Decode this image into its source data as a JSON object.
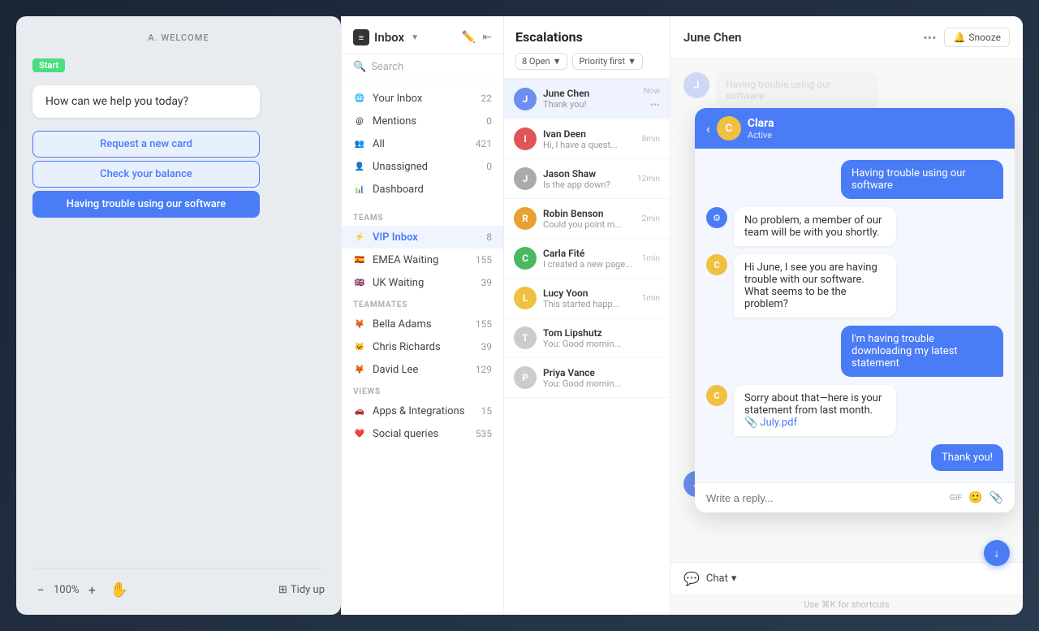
{
  "chatbot": {
    "label": "A. WELCOME",
    "start_badge": "Start",
    "bot_question": "How can we help you today?",
    "buttons": [
      {
        "id": "request-card",
        "label": "Request a new card"
      },
      {
        "id": "check-balance",
        "label": "Check your balance"
      },
      {
        "id": "trouble-software",
        "label": "Having trouble using our software"
      }
    ],
    "zoom": "100%",
    "tidy_label": "Tidy up"
  },
  "inbox": {
    "title": "Inbox",
    "search_placeholder": "Search",
    "items": [
      {
        "id": "your-inbox",
        "icon": "🌐",
        "label": "Your Inbox",
        "count": "22"
      },
      {
        "id": "mentions",
        "icon": "@",
        "label": "Mentions",
        "count": "0"
      },
      {
        "id": "all",
        "icon": "👥",
        "label": "All",
        "count": "421"
      },
      {
        "id": "unassigned",
        "icon": "👤",
        "label": "Unassigned",
        "count": "0"
      },
      {
        "id": "dashboard",
        "icon": "📊",
        "label": "Dashboard",
        "count": ""
      }
    ],
    "teams_label": "TEAMS",
    "teams": [
      {
        "id": "vip-inbox",
        "icon": "⚡",
        "label": "VIP Inbox",
        "count": "8",
        "active": true
      },
      {
        "id": "emea-waiting",
        "icon": "🇪🇸",
        "label": "EMEA Waiting",
        "count": "155"
      },
      {
        "id": "uk-waiting",
        "icon": "🇬🇧",
        "label": "UK Waiting",
        "count": "39"
      }
    ],
    "teammates_label": "TEAMMATES",
    "teammates": [
      {
        "id": "bella-adams",
        "icon": "🦊",
        "label": "Bella Adams",
        "count": "155"
      },
      {
        "id": "chris-richards",
        "icon": "🐱",
        "label": "Chris Richards",
        "count": "39"
      },
      {
        "id": "david-lee",
        "icon": "🦊",
        "label": "David Lee",
        "count": "129"
      }
    ],
    "views_label": "VIEWS",
    "views": [
      {
        "id": "apps-integrations",
        "icon": "🚗",
        "label": "Apps & Integrations",
        "count": "15"
      },
      {
        "id": "social-queries",
        "icon": "❤️",
        "label": "Social queries",
        "count": "535"
      }
    ]
  },
  "escalations": {
    "title": "Escalations",
    "filter_open": "8 Open",
    "filter_priority": "Priority first",
    "conversations": [
      {
        "id": "june-chen",
        "name": "June Chen",
        "preview": "Thank you!",
        "time": "Now",
        "color": "#6b8ef0",
        "active": true
      },
      {
        "id": "ivan-deen",
        "name": "Ivan Deen",
        "preview": "Hi, I have a quest...",
        "time": "8min",
        "color": "#e05555"
      },
      {
        "id": "jason-shaw",
        "name": "Jason Shaw",
        "preview": "Is the app down?",
        "time": "12min",
        "color": "#aaa"
      },
      {
        "id": "robin-benson",
        "name": "Robin Benson",
        "preview": "Could you point m...",
        "time": "2min",
        "color": "#e8a030"
      },
      {
        "id": "carla-fite",
        "name": "Carla Fité",
        "preview": "I created a new page...",
        "time": "1min",
        "color": "#4ab860"
      },
      {
        "id": "lucy-yoon",
        "name": "Lucy Yoon",
        "preview": "This started happ...",
        "time": "1min",
        "color": "#f0c040"
      },
      {
        "id": "tom-lipshutz",
        "name": "Tom Lipshutz",
        "preview": "You: Good mornin...",
        "time": "",
        "color": "#ccc"
      },
      {
        "id": "priya-vance",
        "name": "Priya Vance",
        "preview": "You: Good mornin...",
        "time": "",
        "color": "#ccc"
      }
    ]
  },
  "chat": {
    "contact_name": "June Chen",
    "snooze_label": "Snooze",
    "bg_messages": [
      "Having trouble using our software",
      "a member of our team will be with you shortly.",
      "trouble with"
    ],
    "popup": {
      "agent_name": "Clara",
      "agent_status": "Active",
      "messages": [
        {
          "type": "user",
          "text": "Having trouble using our software"
        },
        {
          "type": "bot",
          "text": "No problem, a member of our team will be with you shortly."
        },
        {
          "type": "agent",
          "text": "Hi June, I see you are having trouble with our software. What seems to be the problem?"
        },
        {
          "type": "user",
          "text": "I'm having trouble downloading my latest statement"
        },
        {
          "type": "agent_file",
          "text": "Sorry about that—here is your statement from last month.",
          "file": "July.pdf"
        },
        {
          "type": "user",
          "text": "Thank you!"
        }
      ],
      "input_placeholder": "Write a reply...",
      "gif_label": "GIF"
    },
    "thank_you_text": "Thank you!",
    "footer_chat": "Chat",
    "shortcut_hint": "Use ⌘K for shortcuts"
  }
}
